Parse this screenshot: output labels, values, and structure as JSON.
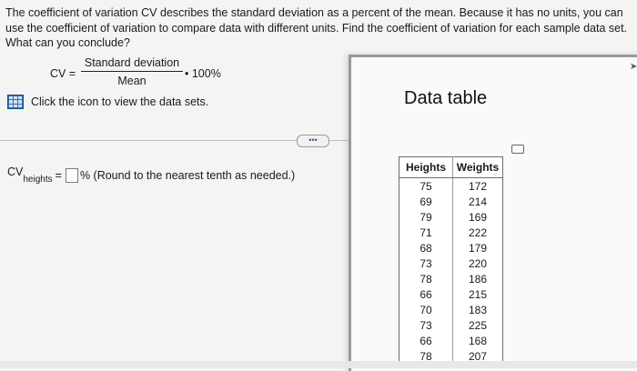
{
  "question": {
    "text": "The coefficient of variation CV describes the standard deviation as a percent of the mean. Because it has no units, you can use the coefficient of variation to compare data with different units. Find the coefficient of variation for each sample data set. What can you conclude?"
  },
  "formula": {
    "lhs": "CV =",
    "numerator": "Standard deviation",
    "denominator": "Mean",
    "multiplier": "• 100%"
  },
  "dataset_link": {
    "icon": "grid-icon",
    "label": "Click the icon to view the data sets."
  },
  "more_button": {
    "label": "•••"
  },
  "answer": {
    "cv": "CV",
    "subscript": "heights",
    "equals": "=",
    "value": "",
    "suffix": "% (Round to the nearest tenth as needed.)"
  },
  "popup": {
    "title": "Data table",
    "tools_icon": "square-icon"
  },
  "table": {
    "headers": [
      "Heights",
      "Weights"
    ],
    "rows": [
      [
        "75",
        "172"
      ],
      [
        "69",
        "214"
      ],
      [
        "79",
        "169"
      ],
      [
        "71",
        "222"
      ],
      [
        "68",
        "179"
      ],
      [
        "73",
        "220"
      ],
      [
        "78",
        "186"
      ],
      [
        "66",
        "215"
      ],
      [
        "70",
        "183"
      ],
      [
        "73",
        "225"
      ],
      [
        "66",
        "168"
      ],
      [
        "78",
        "207"
      ]
    ]
  }
}
